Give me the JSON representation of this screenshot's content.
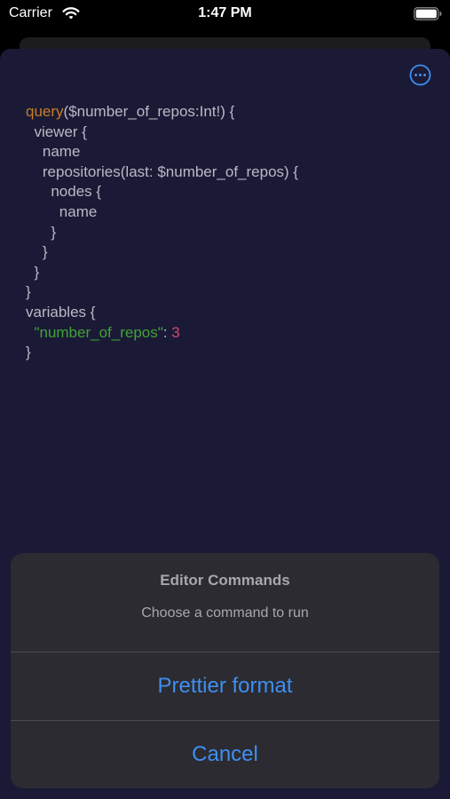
{
  "status_bar": {
    "carrier": "Carrier",
    "time": "1:47 PM"
  },
  "editor": {
    "lines": [
      [
        {
          "t": "query",
          "c": "kw"
        },
        {
          "t": "($number_of_repos:Int!) {",
          "c": ""
        }
      ],
      [
        {
          "t": "  viewer {",
          "c": ""
        }
      ],
      [
        {
          "t": "    name",
          "c": ""
        }
      ],
      [
        {
          "t": "    repositories(last: $number_of_repos) {",
          "c": ""
        }
      ],
      [
        {
          "t": "      nodes {",
          "c": ""
        }
      ],
      [
        {
          "t": "        name",
          "c": ""
        }
      ],
      [
        {
          "t": "      }",
          "c": ""
        }
      ],
      [
        {
          "t": "    }",
          "c": ""
        }
      ],
      [
        {
          "t": "  }",
          "c": ""
        }
      ],
      [
        {
          "t": "}",
          "c": ""
        }
      ],
      [
        {
          "t": "variables {",
          "c": ""
        }
      ],
      [
        {
          "t": "  ",
          "c": ""
        },
        {
          "t": "\"number_of_repos\"",
          "c": "str"
        },
        {
          "t": ": ",
          "c": ""
        },
        {
          "t": "3",
          "c": "num"
        }
      ],
      [
        {
          "t": "}",
          "c": ""
        }
      ]
    ]
  },
  "action_sheet": {
    "title": "Editor Commands",
    "message": "Choose a command to run",
    "prettier_label": "Prettier format",
    "cancel_label": "Cancel"
  },
  "colors": {
    "sheet_background": "#1b1a36",
    "keyword": "#c67e1f",
    "string": "#3fa336",
    "number": "#d04a6b",
    "action_tint": "#3f8ff1"
  },
  "icons": {
    "more": "ellipsis-circle-icon",
    "wifi": "wifi-icon",
    "battery": "battery-icon"
  }
}
